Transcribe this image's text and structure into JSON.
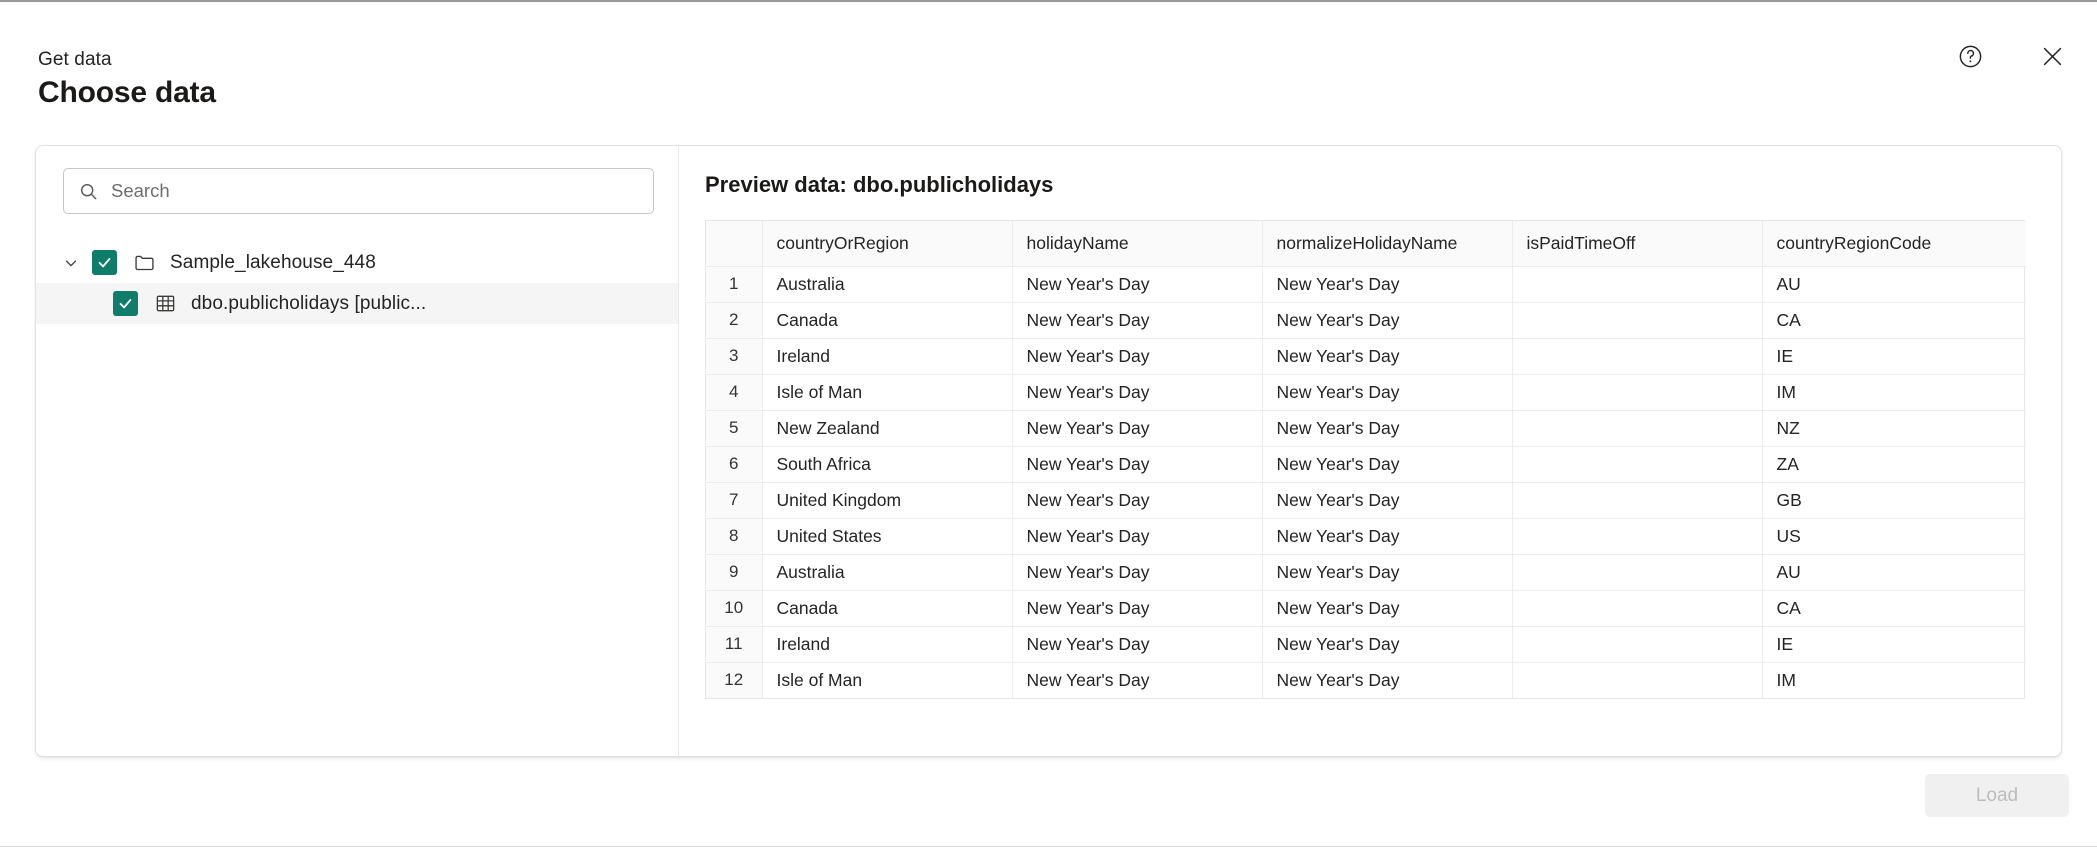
{
  "window": {
    "eyebrow": "Get data",
    "title": "Choose data"
  },
  "header": {
    "help_icon": "help-circle-icon",
    "close_icon": "close-icon"
  },
  "colors": {
    "checkbox_accent": "#107C6A",
    "card_border": "#E3E3E3",
    "grid_line": "#ECECEC",
    "header_row_bg": "#FAFAFA",
    "selected_row_bg": "#F5F5F5",
    "disabled_button_bg": "#F0F0F0",
    "disabled_button_text": "#BDBDBD"
  },
  "search": {
    "placeholder": "Search",
    "value": "",
    "icon": "search-icon"
  },
  "tree": {
    "items": [
      {
        "label": "Sample_lakehouse_448",
        "level": 0,
        "checked": true,
        "expanded": true,
        "icon": "folder-icon",
        "chevron": "chevron-down-icon",
        "selected": false
      },
      {
        "label": "dbo.publicholidays [public...",
        "level": 1,
        "checked": true,
        "expanded": false,
        "icon": "table-icon",
        "chevron": "",
        "selected": true
      }
    ]
  },
  "preview": {
    "title": "Preview data: dbo.publicholidays",
    "columns": [
      "countryOrRegion",
      "holidayName",
      "normalizeHolidayName",
      "isPaidTimeOff",
      "countryRegionCode"
    ],
    "rows": [
      {
        "n": "1",
        "cells": [
          "Australia",
          "New Year's Day",
          "New Year's Day",
          "",
          "AU"
        ]
      },
      {
        "n": "2",
        "cells": [
          "Canada",
          "New Year's Day",
          "New Year's Day",
          "",
          "CA"
        ]
      },
      {
        "n": "3",
        "cells": [
          "Ireland",
          "New Year's Day",
          "New Year's Day",
          "",
          "IE"
        ]
      },
      {
        "n": "4",
        "cells": [
          "Isle of Man",
          "New Year's Day",
          "New Year's Day",
          "",
          "IM"
        ]
      },
      {
        "n": "5",
        "cells": [
          "New Zealand",
          "New Year's Day",
          "New Year's Day",
          "",
          "NZ"
        ]
      },
      {
        "n": "6",
        "cells": [
          "South Africa",
          "New Year's Day",
          "New Year's Day",
          "",
          "ZA"
        ]
      },
      {
        "n": "7",
        "cells": [
          "United Kingdom",
          "New Year's Day",
          "New Year's Day",
          "",
          "GB"
        ]
      },
      {
        "n": "8",
        "cells": [
          "United States",
          "New Year's Day",
          "New Year's Day",
          "",
          "US"
        ]
      },
      {
        "n": "9",
        "cells": [
          "Australia",
          "New Year's Day",
          "New Year's Day",
          "",
          "AU"
        ]
      },
      {
        "n": "10",
        "cells": [
          "Canada",
          "New Year's Day",
          "New Year's Day",
          "",
          "CA"
        ]
      },
      {
        "n": "11",
        "cells": [
          "Ireland",
          "New Year's Day",
          "New Year's Day",
          "",
          "IE"
        ]
      },
      {
        "n": "12",
        "cells": [
          "Isle of Man",
          "New Year's Day",
          "New Year's Day",
          "",
          "IM"
        ]
      }
    ]
  },
  "footer": {
    "load_label": "Load",
    "load_disabled": true
  }
}
